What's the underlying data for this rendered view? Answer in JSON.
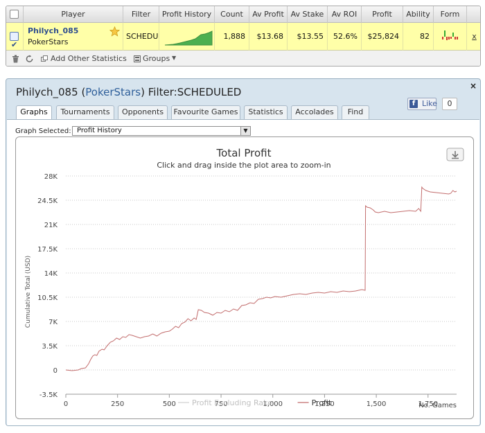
{
  "stats_table": {
    "headers": [
      "Player",
      "Filter",
      "Profit History",
      "Count",
      "Av Profit",
      "Av Stake",
      "Av ROI",
      "Profit",
      "Ability",
      "Form"
    ],
    "row": {
      "player_name": "Philych_085",
      "site": "PokerStars",
      "filter": "SCHEDUL",
      "count": "1,888",
      "av_profit": "$13.68",
      "av_stake": "$13.55",
      "av_roi": "52.6%",
      "profit": "$25,824",
      "ability": "82",
      "remove": "x",
      "form_colors": [
        "#cc3333",
        "#33aa33",
        "#cc3333",
        "#cc3333",
        "#cc3333",
        "#33aa33",
        "#cc3333",
        "#cc3333"
      ]
    },
    "footer": {
      "add_stats": "Add Other Statistics",
      "groups": "Groups"
    }
  },
  "player_window": {
    "title_player": "Philych_085",
    "title_site": "PokerStars",
    "title_filter": "Filter:SCHEDULED",
    "close": "×",
    "like_label": "Like",
    "like_count": "0",
    "tabs": [
      "Graphs",
      "Tournaments",
      "Opponents",
      "Favourite Games",
      "Statistics",
      "Accolades",
      "Find"
    ],
    "active_tab": "Graphs",
    "graph_selected_label": "Graph Selected:",
    "graph_selected_value": "Profit History"
  },
  "chart_data": {
    "type": "line",
    "title": "Total Profit",
    "subtitle": "Click and drag inside the plot area to zoom-in",
    "ylabel": "Cumulative Total (USD)",
    "xlabel": "No. Games",
    "xlim": [
      0,
      1888
    ],
    "ylim": [
      -3500,
      28000
    ],
    "x_ticks": [
      0,
      250,
      500,
      750,
      1000,
      1250,
      1500,
      1750
    ],
    "x_tick_labels": [
      "0",
      "250",
      "500",
      "750",
      "1,000",
      "1,250",
      "1,500",
      "1,750"
    ],
    "y_ticks": [
      -3500,
      0,
      3500,
      7000,
      10500,
      14000,
      17500,
      21000,
      24500,
      28000
    ],
    "y_tick_labels": [
      "-3.5K",
      "0",
      "3.5K",
      "7K",
      "10.5K",
      "14K",
      "17.5K",
      "21K",
      "24.5K",
      "28K"
    ],
    "grid": true,
    "legend_position": "bottom-center",
    "series": [
      {
        "name": "Profit Excluding Rake",
        "color": "#d0d0d0",
        "x": [],
        "y": []
      },
      {
        "name": "Profit",
        "color": "#c26c6c",
        "x": [
          0,
          30,
          60,
          75,
          95,
          110,
          120,
          130,
          140,
          150,
          160,
          175,
          185,
          200,
          215,
          230,
          245,
          260,
          275,
          290,
          305,
          320,
          340,
          360,
          380,
          400,
          420,
          440,
          460,
          480,
          500,
          515,
          530,
          545,
          560,
          575,
          590,
          605,
          620,
          630,
          640,
          655,
          670,
          690,
          710,
          730,
          750,
          770,
          790,
          810,
          830,
          850,
          870,
          890,
          910,
          930,
          950,
          970,
          990,
          1010,
          1040,
          1070,
          1100,
          1130,
          1160,
          1190,
          1220,
          1250,
          1280,
          1310,
          1340,
          1370,
          1400,
          1430,
          1446,
          1448,
          1455,
          1470,
          1485,
          1495,
          1510,
          1540,
          1570,
          1600,
          1630,
          1660,
          1690,
          1705,
          1715,
          1720,
          1725,
          1740,
          1760,
          1790,
          1820,
          1850,
          1860,
          1870,
          1880,
          1888
        ],
        "y": [
          0,
          -100,
          0,
          200,
          300,
          900,
          1500,
          2000,
          2200,
          2100,
          2700,
          3000,
          2900,
          3500,
          4000,
          4200,
          4600,
          4400,
          4800,
          4700,
          5100,
          5000,
          4800,
          4600,
          4800,
          4900,
          5200,
          4900,
          5300,
          5500,
          5600,
          5900,
          6300,
          6100,
          6700,
          6900,
          7400,
          7100,
          7500,
          7300,
          8700,
          8600,
          8300,
          8200,
          7900,
          8300,
          8200,
          8600,
          8400,
          8800,
          8600,
          9300,
          9400,
          9700,
          9600,
          10200,
          10300,
          10500,
          10400,
          10600,
          10500,
          10700,
          10900,
          11000,
          10900,
          11100,
          11200,
          11100,
          11300,
          11200,
          11400,
          11300,
          11400,
          11600,
          11500,
          23700,
          23500,
          23400,
          23100,
          22800,
          22700,
          22900,
          22700,
          22800,
          22900,
          23000,
          22900,
          23300,
          22900,
          26400,
          26200,
          25900,
          25700,
          25600,
          25500,
          25400,
          25500,
          25900,
          25700,
          25800
        ]
      }
    ]
  }
}
